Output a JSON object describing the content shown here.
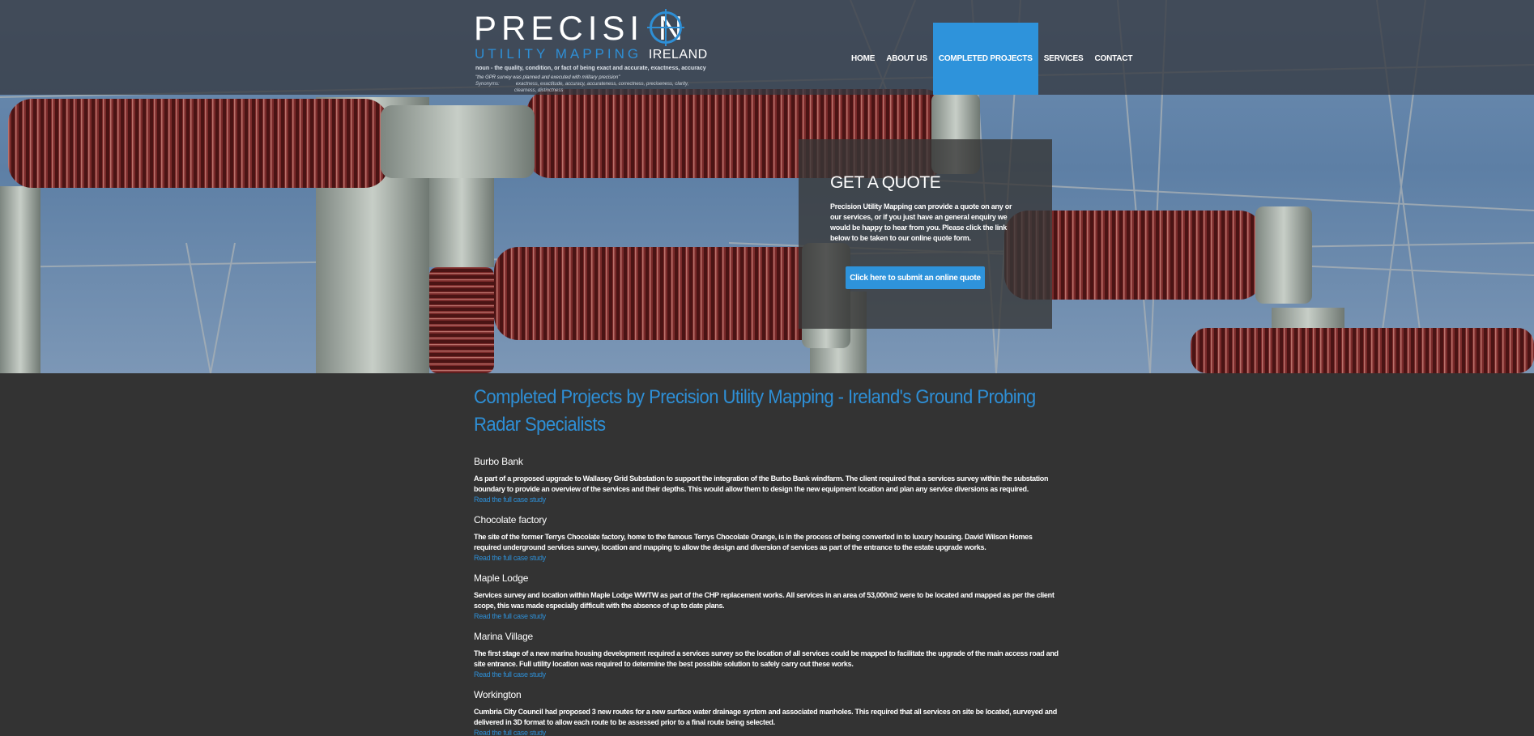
{
  "logo": {
    "word1": "PRECISI N",
    "word2": "UTILITY MAPPING",
    "word3": "IRELAND",
    "definition": "noun - the quality, condition, or fact of being exact and accurate, exactness, accuracy",
    "quote": "\"the GPR survey was planned and executed with military precision\"",
    "synonyms_label": "Synonyms:",
    "synonyms": "exactness, exactitude, accuracy, accurateness, correctness, preciseness, clarity,",
    "synonyms_cont": "clearness, distinctness"
  },
  "nav": {
    "items": [
      {
        "label": "HOME"
      },
      {
        "label": "ABOUT US"
      },
      {
        "label": "COMPLETED PROJECTS"
      },
      {
        "label": "SERVICES"
      },
      {
        "label": "CONTACT"
      }
    ],
    "active": "COMPLETED PROJECTS"
  },
  "quote_box": {
    "title": "GET A QUOTE",
    "text": "Precision Utility Mapping can provide a quote on any or our services, or if you just have an general enquiry we would be happy to hear from you. Please click the link below to be taken to our online quote form.",
    "button": "Click here to submit an online quote"
  },
  "main": {
    "heading": "Completed Projects by Precision Utility Mapping - Ireland's Ground Probing Radar Specialists",
    "projects": [
      {
        "title": "Burbo Bank",
        "text": "As part of a proposed upgrade to Wallasey Grid Substation to support the integration of the Burbo Bank windfarm. The client required that a services survey within the substation boundary to provide an overview of the services and their depths. This would allow them to design the new equipment location and plan any service diversions as required.",
        "link": "Read the full case study"
      },
      {
        "title": "Chocolate factory",
        "text": "The site of the former Terrys Chocolate factory, home to the famous Terrys Chocolate Orange, is in the process of being converted in to luxury housing. David Wilson Homes required underground services survey, location and mapping to allow the design and diversion of services as part of the entrance to the estate upgrade works.",
        "link": "Read the full case study"
      },
      {
        "title": "Maple Lodge",
        "text": "Services survey and location within Maple Lodge WWTW as part of the CHP replacement works. All services in an area of 53,000m2 were to be located and mapped as per the client scope, this was made especially difficult with the absence of up to date plans.",
        "link": "Read the full case study"
      },
      {
        "title": "Marina Village",
        "text": "The first stage of a new marina housing development required a services survey so the location of all services could be mapped to facilitate the upgrade of the main access road and site entrance. Full utility location was required to determine the best possible solution to safely carry out these works.",
        "link": "Read the full case study"
      },
      {
        "title": "Workington",
        "text": "Cumbria City Council had proposed 3 new routes for a new surface water drainage system and associated manholes. This required that all services on site be located, surveyed and delivered in 3D format to allow each route to be assessed prior to a final route being selected.",
        "link": "Read the full case study"
      }
    ]
  },
  "colors": {
    "accent": "#2e93db",
    "background": "#333333",
    "insulator": "#5a1a1a"
  }
}
